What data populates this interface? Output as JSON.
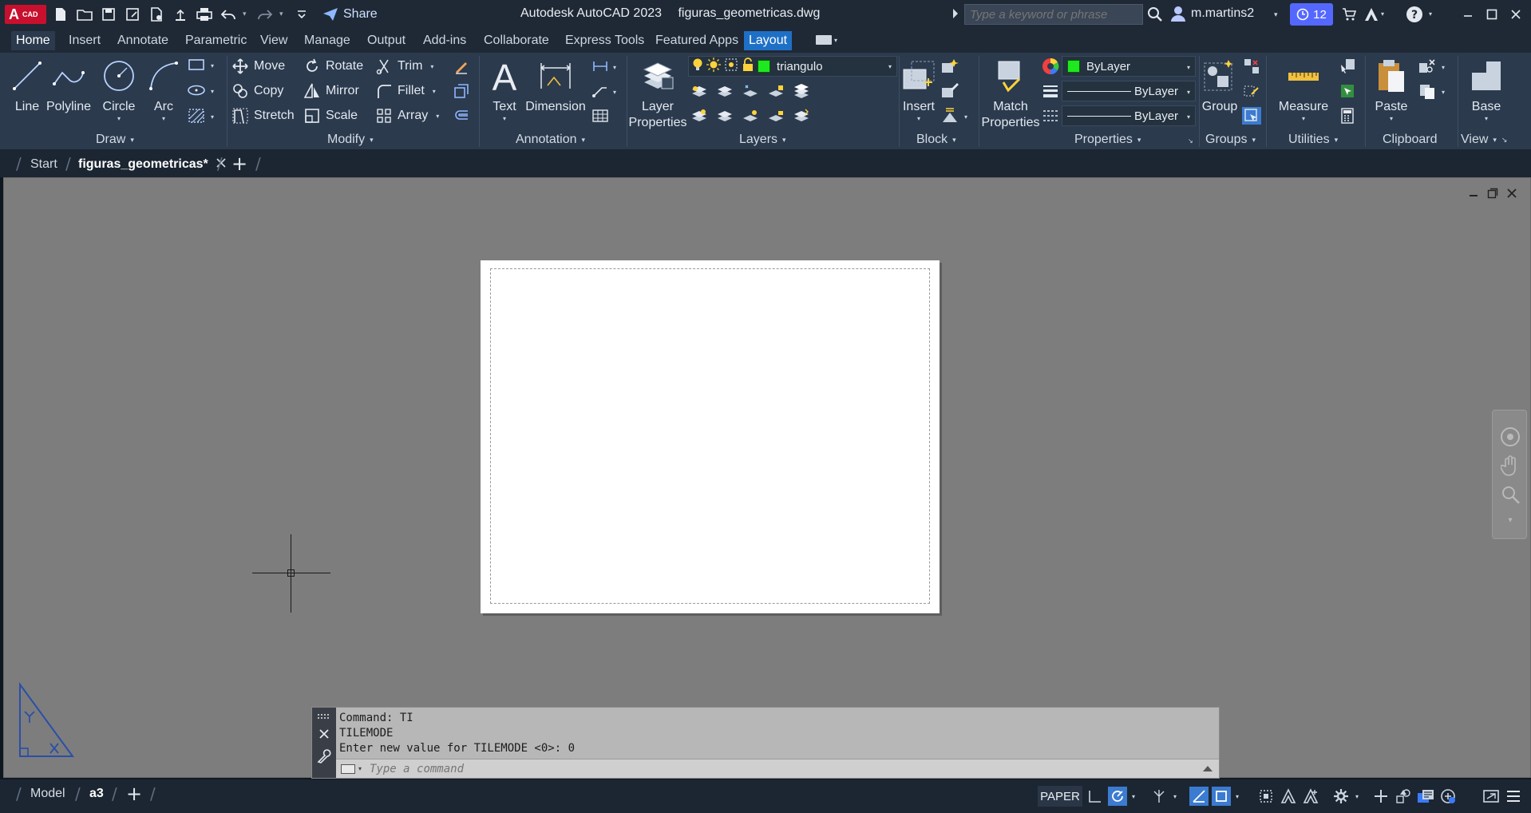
{
  "app": {
    "logo_text": "A",
    "logo_sub": "CAD",
    "title": "Autodesk AutoCAD 2023",
    "filename": "figuras_geometricas.dwg",
    "share_label": "Share",
    "search_placeholder": "Type a keyword or phrase",
    "username": "m.martins2",
    "notification_count": "12"
  },
  "ribbon_tabs": [
    "Home",
    "Insert",
    "Annotate",
    "Parametric",
    "View",
    "Manage",
    "Output",
    "Add-ins",
    "Collaborate",
    "Express Tools",
    "Featured Apps",
    "Layout"
  ],
  "active_ribbon_tab": "Home",
  "panels": {
    "draw": {
      "title": "Draw",
      "tools": [
        "Line",
        "Polyline",
        "Circle",
        "Arc"
      ]
    },
    "modify": {
      "title": "Modify",
      "tools": [
        "Move",
        "Rotate",
        "Trim",
        "Copy",
        "Mirror",
        "Fillet",
        "Stretch",
        "Scale",
        "Array"
      ]
    },
    "annotation": {
      "title": "Annotation",
      "tools": [
        "Text",
        "Dimension"
      ]
    },
    "layers": {
      "title": "Layers",
      "properties_label_1": "Layer",
      "properties_label_2": "Properties",
      "current_layer": "triangulo",
      "layer_color": "#1ee81e"
    },
    "block": {
      "title": "Block",
      "insert_label": "Insert"
    },
    "properties": {
      "title": "Properties",
      "match_label_1": "Match",
      "match_label_2": "Properties",
      "color": "ByLayer",
      "linetype": "ByLayer",
      "lineweight": "ByLayer"
    },
    "groups": {
      "title": "Groups",
      "group_label": "Group"
    },
    "utilities": {
      "title": "Utilities",
      "measure_label": "Measure"
    },
    "clipboard": {
      "title": "Clipboard",
      "paste_label": "Paste"
    },
    "view": {
      "title": "View",
      "base_label": "Base"
    }
  },
  "file_tabs": {
    "start": "Start",
    "active": "figuras_geometricas*"
  },
  "command_line": {
    "history": [
      "Command: TI",
      "TILEMODE",
      "Enter new value for TILEMODE <0>: 0"
    ],
    "placeholder": "Type a command"
  },
  "layout_tabs": {
    "model": "Model",
    "active": "a3"
  },
  "status": {
    "space": "PAPER"
  },
  "colors": {
    "accent": "#1e70c6",
    "ribbon_bg": "#2b3a4d",
    "canvas_bg": "#7d7d7d",
    "badge": "#5468ff"
  }
}
